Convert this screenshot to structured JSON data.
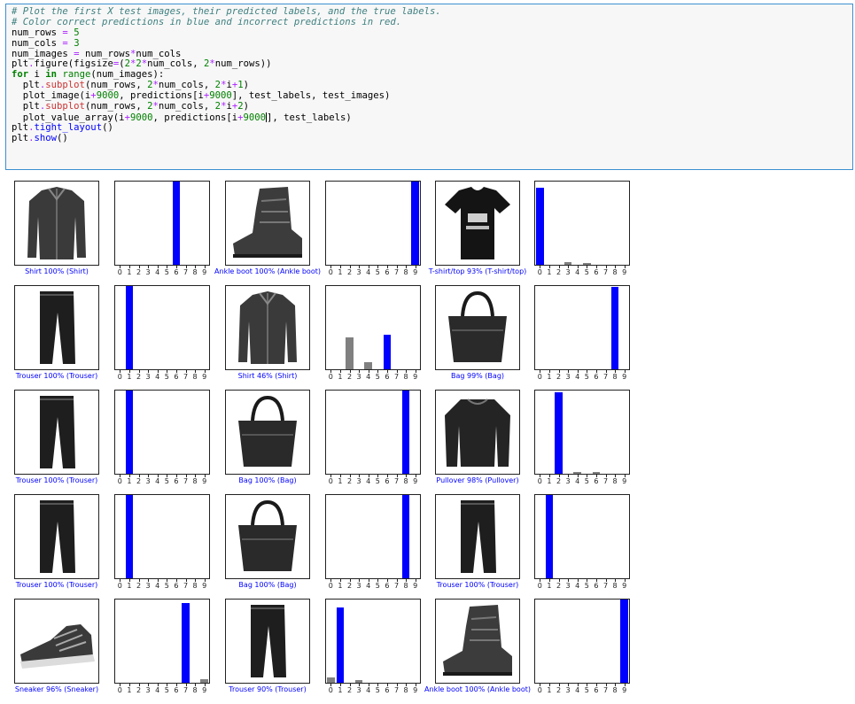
{
  "code_cell": {
    "lines": [
      [
        {
          "t": "# Plot the first X test images, their predicted labels, and the true labels.",
          "c": "tok-c"
        }
      ],
      [
        {
          "t": "# Color correct predictions in blue and incorrect predictions in red.",
          "c": "tok-c"
        }
      ],
      [
        {
          "t": "num_rows "
        },
        {
          "t": "=",
          "c": "tok-o"
        },
        {
          "t": " "
        },
        {
          "t": "5",
          "c": "tok-n"
        }
      ],
      [
        {
          "t": "num_cols "
        },
        {
          "t": "=",
          "c": "tok-o"
        },
        {
          "t": " "
        },
        {
          "t": "3",
          "c": "tok-n"
        }
      ],
      [
        {
          "t": "num_images "
        },
        {
          "t": "=",
          "c": "tok-o"
        },
        {
          "t": " num_rows"
        },
        {
          "t": "*",
          "c": "tok-o"
        },
        {
          "t": "num_cols"
        }
      ],
      [
        {
          "t": "plt"
        },
        {
          "t": ".",
          "c": "tok-o"
        },
        {
          "t": "figure(figsize"
        },
        {
          "t": "=",
          "c": "tok-o"
        },
        {
          "t": "("
        },
        {
          "t": "2",
          "c": "tok-n"
        },
        {
          "t": "*",
          "c": "tok-o"
        },
        {
          "t": "2",
          "c": "tok-n"
        },
        {
          "t": "*",
          "c": "tok-o"
        },
        {
          "t": "num_cols, "
        },
        {
          "t": "2",
          "c": "tok-n"
        },
        {
          "t": "*",
          "c": "tok-o"
        },
        {
          "t": "num_rows))"
        }
      ],
      [
        {
          "t": "for",
          "c": "tok-k"
        },
        {
          "t": " i "
        },
        {
          "t": "in",
          "c": "tok-kw"
        },
        {
          "t": " "
        },
        {
          "t": "range",
          "c": "tok-n"
        },
        {
          "t": "(num_images):"
        }
      ],
      [
        {
          "t": "  plt"
        },
        {
          "t": ".",
          "c": "tok-o"
        },
        {
          "t": "subplot",
          "c": "tok-r"
        },
        {
          "t": "(num_rows, "
        },
        {
          "t": "2",
          "c": "tok-n"
        },
        {
          "t": "*",
          "c": "tok-o"
        },
        {
          "t": "num_cols, "
        },
        {
          "t": "2",
          "c": "tok-n"
        },
        {
          "t": "*",
          "c": "tok-o"
        },
        {
          "t": "i"
        },
        {
          "t": "+",
          "c": "tok-o"
        },
        {
          "t": "1",
          "c": "tok-n"
        },
        {
          "t": ")"
        }
      ],
      [
        {
          "t": "  plot_image(i"
        },
        {
          "t": "+",
          "c": "tok-o"
        },
        {
          "t": "9000",
          "c": "tok-n"
        },
        {
          "t": ", predictions[i"
        },
        {
          "t": "+",
          "c": "tok-o"
        },
        {
          "t": "9000",
          "c": "tok-n"
        },
        {
          "t": "], test_labels, test_images)"
        }
      ],
      [
        {
          "t": "  plt"
        },
        {
          "t": ".",
          "c": "tok-o"
        },
        {
          "t": "subplot",
          "c": "tok-r"
        },
        {
          "t": "(num_rows, "
        },
        {
          "t": "2",
          "c": "tok-n"
        },
        {
          "t": "*",
          "c": "tok-o"
        },
        {
          "t": "num_cols, "
        },
        {
          "t": "2",
          "c": "tok-n"
        },
        {
          "t": "*",
          "c": "tok-o"
        },
        {
          "t": "i"
        },
        {
          "t": "+",
          "c": "tok-o"
        },
        {
          "t": "2",
          "c": "tok-n"
        },
        {
          "t": ")"
        }
      ],
      [
        {
          "t": "  plot_value_array(i"
        },
        {
          "t": "+",
          "c": "tok-o"
        },
        {
          "t": "9000",
          "c": "tok-n"
        },
        {
          "t": ", predictions[i"
        },
        {
          "t": "+",
          "c": "tok-o"
        },
        {
          "t": "9000",
          "c": "tok-n"
        },
        {
          "t": "CURSOR"
        },
        {
          "t": "], test_labels)"
        }
      ],
      [
        {
          "t": "plt"
        },
        {
          "t": ".",
          "c": "tok-o"
        },
        {
          "t": "tight_layout",
          "c": "tok-f"
        },
        {
          "t": "()"
        }
      ],
      [
        {
          "t": "plt"
        },
        {
          "t": ".",
          "c": "tok-o"
        },
        {
          "t": "show",
          "c": "tok-f"
        },
        {
          "t": "()"
        }
      ]
    ]
  },
  "figure": {
    "class_ticks": [
      "0",
      "1",
      "2",
      "3",
      "4",
      "5",
      "6",
      "7",
      "8",
      "9"
    ],
    "colors": {
      "correct": "#0000ff",
      "other": "#808080",
      "caption": "#0000ff"
    },
    "panels": [
      {
        "caption": "Shirt 100% (Shirt)",
        "image_icon": "shirt-image",
        "values": [
          0,
          0,
          0,
          0,
          0,
          0,
          1.0,
          0,
          0,
          0
        ]
      },
      {
        "caption": "Ankle boot 100% (Ankle boot)",
        "image_icon": "ankle-boot-image",
        "values": [
          0,
          0,
          0,
          0,
          0,
          0,
          0,
          0,
          0,
          1.0
        ]
      },
      {
        "caption": "T-shirt/top 93% (T-shirt/top)",
        "image_icon": "tshirt-image",
        "values": [
          0.93,
          0,
          0,
          0.03,
          0,
          0.02,
          0,
          0,
          0,
          0
        ]
      },
      {
        "caption": "Trouser 100% (Trouser)",
        "image_icon": "trouser-image",
        "values": [
          0,
          1.0,
          0,
          0,
          0,
          0,
          0,
          0,
          0,
          0
        ]
      },
      {
        "caption": "Shirt 46% (Shirt)",
        "image_icon": "shirt-image",
        "values": [
          0,
          0,
          0.38,
          0,
          0.08,
          0,
          0.42,
          0,
          0,
          0
        ],
        "correct_index": 6
      },
      {
        "caption": "Bag 99% (Bag)",
        "image_icon": "bag-image",
        "values": [
          0,
          0,
          0,
          0,
          0,
          0,
          0,
          0,
          0.99,
          0
        ]
      },
      {
        "caption": "Trouser 100% (Trouser)",
        "image_icon": "trouser-image",
        "values": [
          0,
          1.0,
          0,
          0,
          0,
          0,
          0,
          0,
          0,
          0
        ]
      },
      {
        "caption": "Bag 100% (Bag)",
        "image_icon": "bag-image",
        "values": [
          0,
          0,
          0,
          0,
          0,
          0,
          0,
          0,
          1.0,
          0
        ]
      },
      {
        "caption": "Pullover 98% (Pullover)",
        "image_icon": "pullover-image",
        "values": [
          0,
          0,
          0.98,
          0,
          0.01,
          0,
          0.01,
          0,
          0,
          0
        ]
      },
      {
        "caption": "Trouser 100% (Trouser)",
        "image_icon": "trouser-image",
        "values": [
          0,
          1.0,
          0,
          0,
          0,
          0,
          0,
          0,
          0,
          0
        ]
      },
      {
        "caption": "Bag 100% (Bag)",
        "image_icon": "bag-image",
        "values": [
          0,
          0,
          0,
          0,
          0,
          0,
          0,
          0,
          1.0,
          0
        ]
      },
      {
        "caption": "Trouser 100% (Trouser)",
        "image_icon": "trouser-image",
        "values": [
          0,
          1.0,
          0,
          0,
          0,
          0,
          0,
          0,
          0,
          0
        ]
      },
      {
        "caption": "Sneaker 96% (Sneaker)",
        "image_icon": "sneaker-image",
        "values": [
          0,
          0,
          0,
          0,
          0,
          0,
          0,
          0.96,
          0,
          0.04
        ]
      },
      {
        "caption": "Trouser 90% (Trouser)",
        "image_icon": "trouser-image",
        "values": [
          0.06,
          0.9,
          0,
          0.03,
          0,
          0,
          0,
          0,
          0,
          0
        ]
      },
      {
        "caption": "Ankle boot 100% (Ankle boot)",
        "image_icon": "ankle-boot-image",
        "values": [
          0,
          0,
          0,
          0,
          0,
          0,
          0,
          0,
          0,
          1.0
        ]
      }
    ]
  }
}
